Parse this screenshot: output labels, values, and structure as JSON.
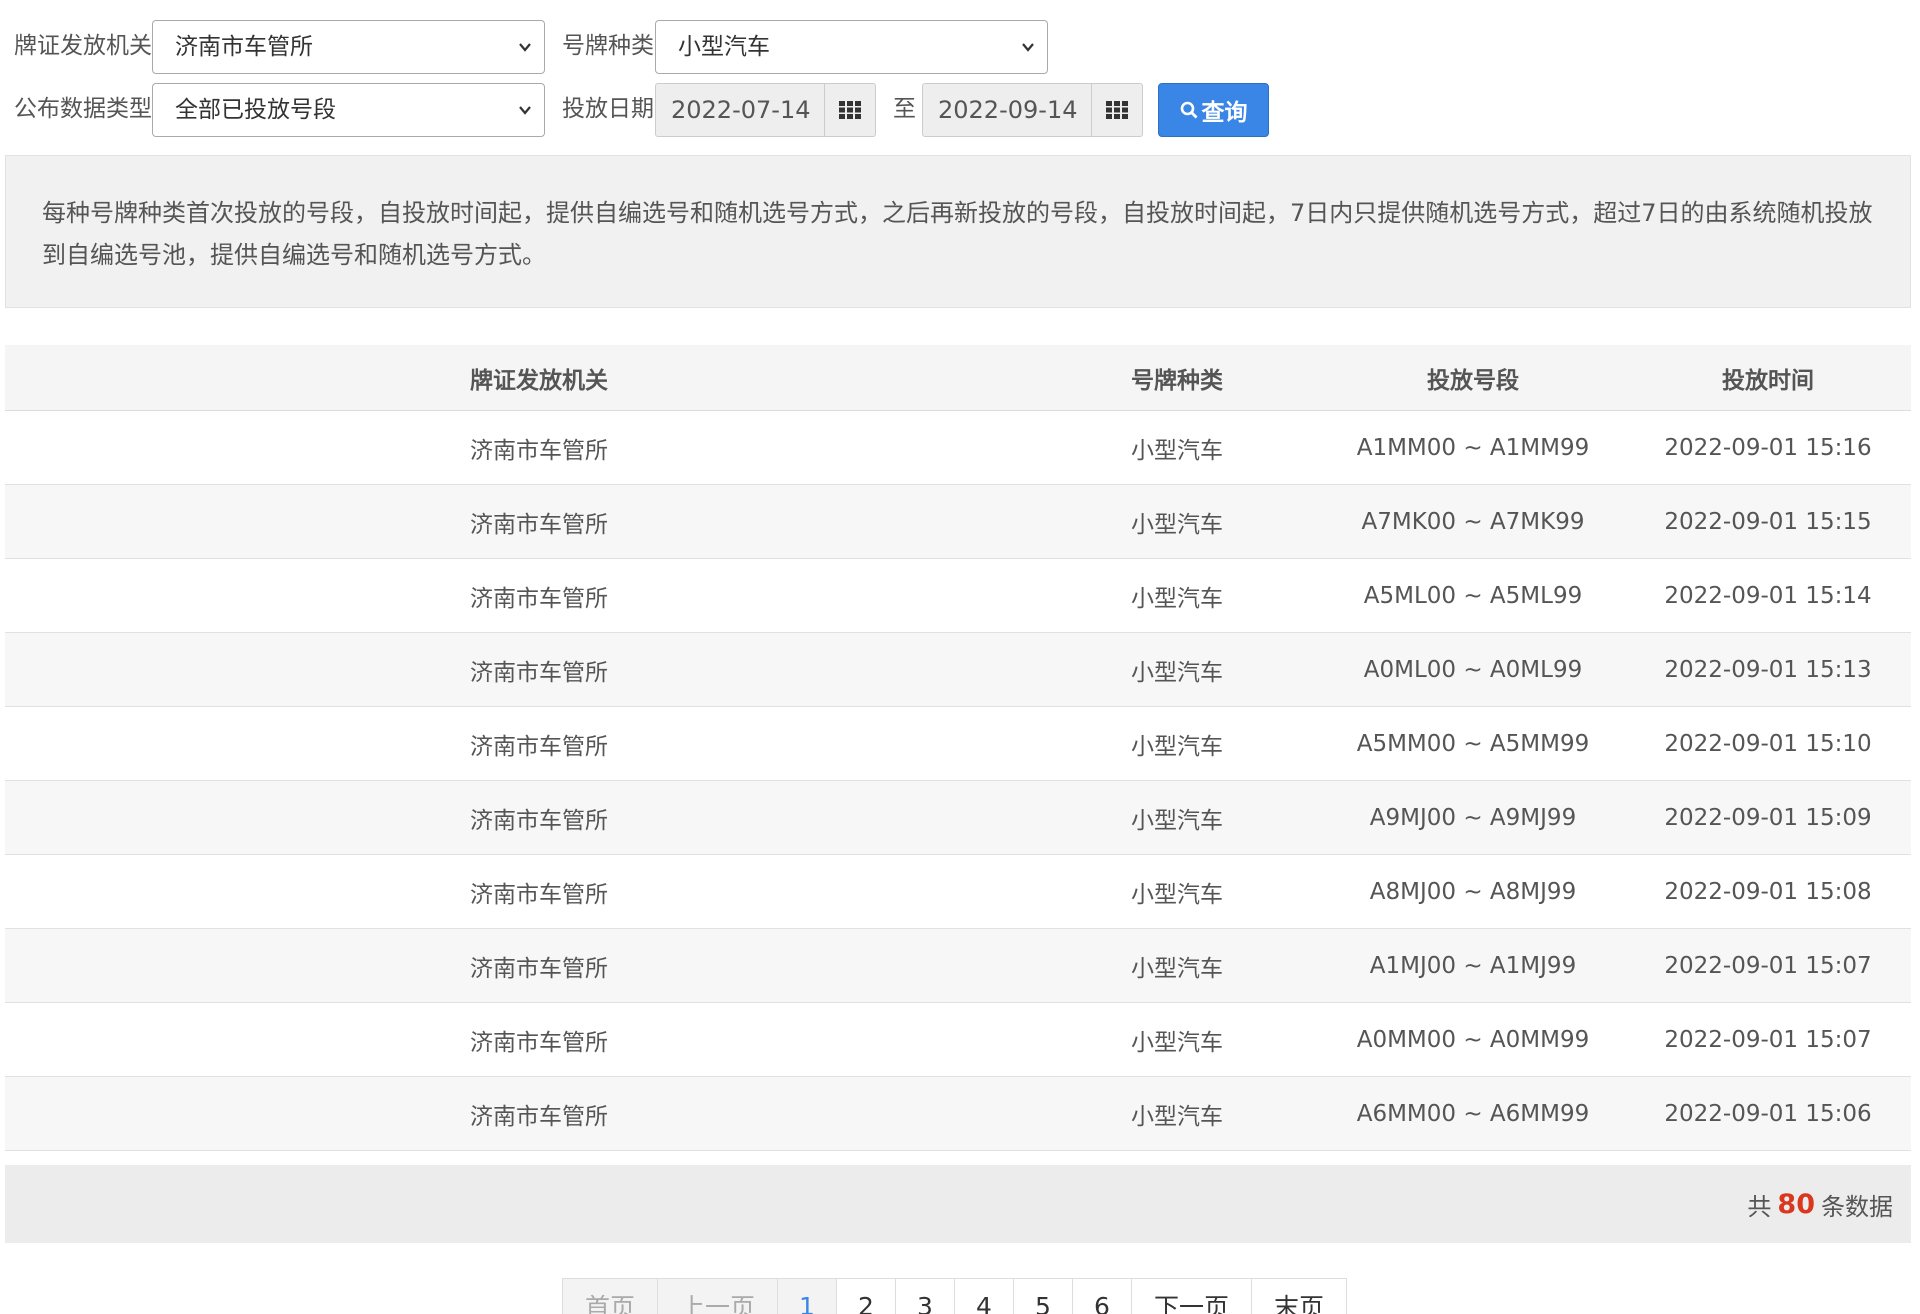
{
  "filters": {
    "issuer_label": "牌证发放机关",
    "issuer_value": "济南市车管所",
    "plate_type_label": "号牌种类",
    "plate_type_value": "小型汽车",
    "data_type_label": "公布数据类型",
    "data_type_value": "全部已投放号段",
    "date_label": "投放日期",
    "date_from": "2022-07-14",
    "date_to_sep": "至",
    "date_to": "2022-09-14",
    "query_label": "查询"
  },
  "notice": {
    "text": "每种号牌种类首次投放的号段，自投放时间起，提供自编选号和随机选号方式，之后再新投放的号段，自投放时间起，7日内只提供随机选号方式，超过7日的由系统随机投放到自编选号池，提供自编选号和随机选号方式。"
  },
  "table": {
    "headers": [
      "牌证发放机关",
      "号牌种类",
      "投放号段",
      "投放时间"
    ],
    "rows": [
      [
        "济南市车管所",
        "小型汽车",
        "A1MM00 ~ A1MM99",
        "2022-09-01 15:16"
      ],
      [
        "济南市车管所",
        "小型汽车",
        "A7MK00 ~ A7MK99",
        "2022-09-01 15:15"
      ],
      [
        "济南市车管所",
        "小型汽车",
        "A5ML00 ~ A5ML99",
        "2022-09-01 15:14"
      ],
      [
        "济南市车管所",
        "小型汽车",
        "A0ML00 ~ A0ML99",
        "2022-09-01 15:13"
      ],
      [
        "济南市车管所",
        "小型汽车",
        "A5MM00 ~ A5MM99",
        "2022-09-01 15:10"
      ],
      [
        "济南市车管所",
        "小型汽车",
        "A9MJ00 ~ A9MJ99",
        "2022-09-01 15:09"
      ],
      [
        "济南市车管所",
        "小型汽车",
        "A8MJ00 ~ A8MJ99",
        "2022-09-01 15:08"
      ],
      [
        "济南市车管所",
        "小型汽车",
        "A1MJ00 ~ A1MJ99",
        "2022-09-01 15:07"
      ],
      [
        "济南市车管所",
        "小型汽车",
        "A0MM00 ~ A0MM99",
        "2022-09-01 15:07"
      ],
      [
        "济南市车管所",
        "小型汽车",
        "A6MM00 ~ A6MM99",
        "2022-09-01 15:06"
      ]
    ]
  },
  "summary": {
    "prefix": "共",
    "count": "80",
    "suffix": "条数据"
  },
  "pagination": {
    "first": "首页",
    "prev": "上一页",
    "pages": [
      "1",
      "2",
      "3",
      "4",
      "5",
      "6"
    ],
    "next": "下一页",
    "last": "末页",
    "current": "1"
  },
  "colors": {
    "accent": "#3a86e6",
    "count_red": "#d9381e"
  },
  "icons": {
    "select_arrow": "chevron-down-icon",
    "calendar": "calendar-grid-icon",
    "search": "search-icon"
  }
}
